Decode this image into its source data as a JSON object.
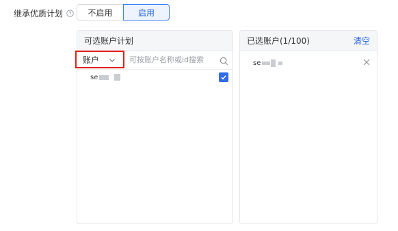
{
  "form": {
    "inherit_label": "继承优质计划",
    "toggle_off": "不启用",
    "toggle_on": "启用"
  },
  "left_panel": {
    "title": "可选账户计划",
    "select_value": "账户",
    "search_placeholder": "可按账户名称或id搜索",
    "items": [
      {
        "name_visible": "se",
        "checked": true
      }
    ]
  },
  "right_panel": {
    "title": "已选账户(1/100)",
    "clear_label": "清空",
    "items": [
      {
        "name_visible": "se"
      }
    ]
  },
  "colors": {
    "accent": "#1f5fe0",
    "highlight_border": "#e0201b",
    "checkbox": "#2f6bea"
  },
  "icons": [
    "help-icon",
    "chevron-down-icon",
    "search-icon",
    "check-icon",
    "close-icon"
  ]
}
